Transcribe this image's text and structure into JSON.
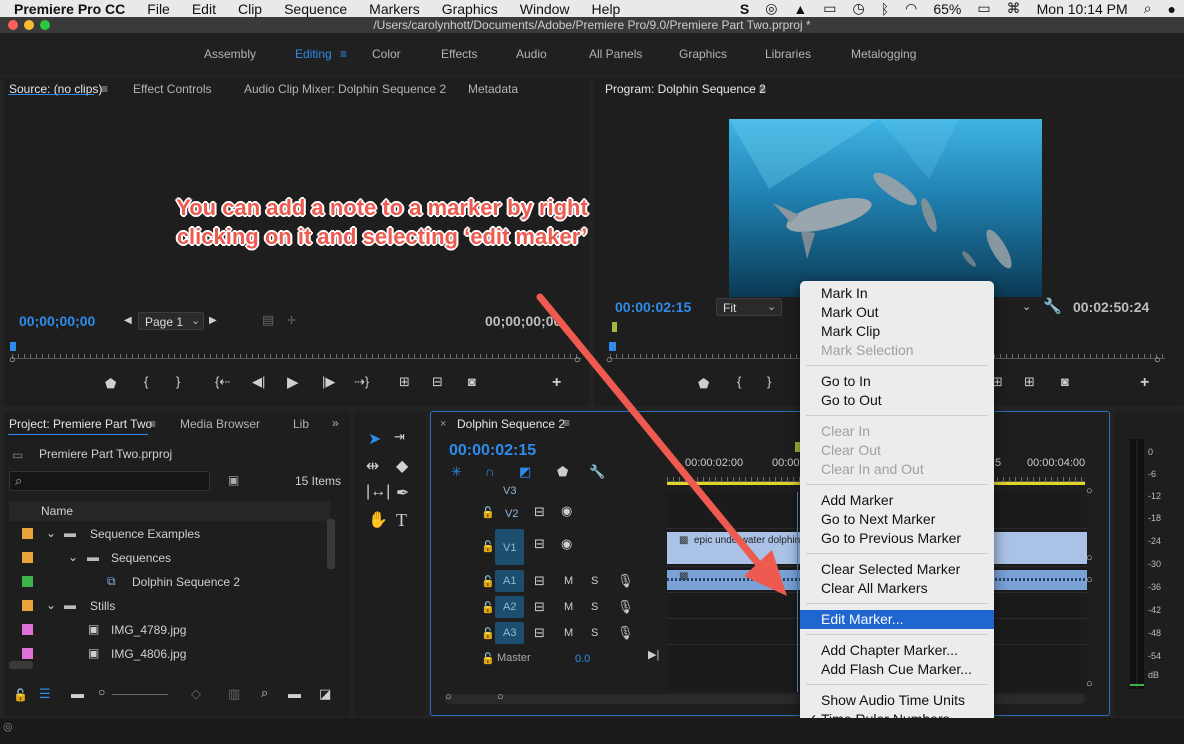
{
  "menubar": {
    "app_name": "Premiere Pro CC",
    "menus": [
      "File",
      "Edit",
      "Clip",
      "Sequence",
      "Markers",
      "Graphics",
      "Window",
      "Help"
    ],
    "battery": "65%",
    "clock": "Mon 10:14 PM"
  },
  "window": {
    "title": "/Users/carolynhott/Documents/Adobe/Premiere Pro/9.0/Premiere Part Two.prproj *"
  },
  "workspaces": [
    "Assembly",
    "Editing",
    "Color",
    "Effects",
    "Audio",
    "All Panels",
    "Graphics",
    "Libraries",
    "Metalogging"
  ],
  "source_panel": {
    "tabs": [
      "Source: (no clips)",
      "Effect Controls",
      "Audio Clip Mixer: Dolphin Sequence 2",
      "Metadata"
    ],
    "timecode_in": "00;00;00;00",
    "timecode_out": "00;00;00;00",
    "page_select": "Page 1"
  },
  "program_panel": {
    "title": "Program: Dolphin Sequence 2",
    "timecode": "00:00:02:15",
    "fit_select": "Fit",
    "duration": "00:02:50:24"
  },
  "project_panel": {
    "tabs": [
      "Project: Premiere Part Two",
      "Media Browser",
      "Lib"
    ],
    "project_file": "Premiere Part Two.prproj",
    "items_count": "15 Items",
    "column_name": "Name",
    "rows": [
      {
        "label": "Sequence Examples",
        "color": "#e8a33b"
      },
      {
        "label": "Sequences",
        "color": "#e8a33b"
      },
      {
        "label": "Dolphin Sequence 2",
        "color": "#3bb44a"
      },
      {
        "label": "Stills",
        "color": "#e8a33b"
      },
      {
        "label": "IMG_4789.jpg",
        "color": "#e070d8"
      },
      {
        "label": "IMG_4806.jpg",
        "color": "#e070d8"
      }
    ]
  },
  "timeline": {
    "sequence_tab": "Dolphin Sequence 2",
    "timecode": "00:00:02:15",
    "ruler_marks": [
      "00:00:02:00",
      "00:00",
      "5",
      "00:00:04:00"
    ],
    "tracks": {
      "v3": "V3",
      "v2": "V2",
      "v1": "V1",
      "a1": "A1",
      "a2": "A2",
      "a3": "A3",
      "master": "Master",
      "master_value": "0.0"
    },
    "clip_label": "epic underwater dolphin",
    "meter_labels": [
      "0",
      "-6",
      "-12",
      "-18",
      "-24",
      "-30",
      "-36",
      "-42",
      "-48",
      "-54",
      "dB"
    ]
  },
  "context_menu": {
    "mark_in": "Mark In",
    "mark_out": "Mark Out",
    "mark_clip": "Mark Clip",
    "mark_selection": "Mark Selection",
    "go_to_in": "Go to In",
    "go_to_out": "Go to Out",
    "clear_in": "Clear In",
    "clear_out": "Clear Out",
    "clear_in_out": "Clear In and Out",
    "add_marker": "Add Marker",
    "go_next_marker": "Go to Next Marker",
    "go_prev_marker": "Go to Previous Marker",
    "clear_selected_marker": "Clear Selected Marker",
    "clear_all_markers": "Clear All Markers",
    "edit_marker": "Edit Marker...",
    "add_chapter_marker": "Add Chapter Marker...",
    "add_flash_cue_marker": "Add Flash Cue Marker...",
    "show_audio_time_units": "Show Audio Time Units",
    "time_ruler_numbers": "Time Ruler Numbers",
    "checkmark": "✓"
  },
  "annotation": {
    "line1": "You can add a note to a marker by right",
    "line2": "clicking on it and selecting ‘edit maker’"
  },
  "colors": {
    "accent_blue": "#2d8ceb",
    "menu_highlight": "#1f66d1",
    "arrow_red": "#ee5a4f",
    "clip_video": "#a9c2e6",
    "clip_audio": "#7aa2d6"
  }
}
